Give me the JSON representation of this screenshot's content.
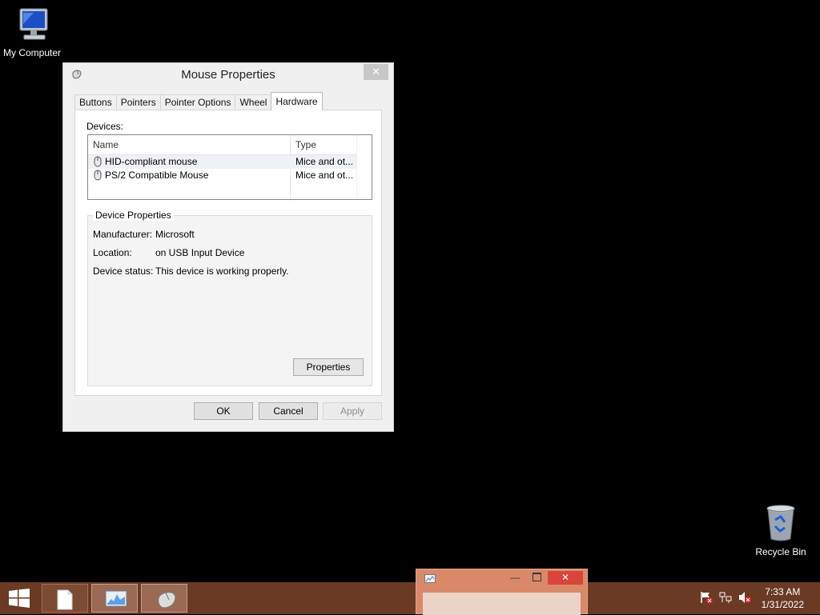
{
  "desktop": {
    "icons": [
      {
        "label": "My Computer",
        "icon": "computer-icon"
      },
      {
        "label": "Recycle Bin",
        "icon": "recycle-bin-icon"
      }
    ]
  },
  "dialog": {
    "title": "Mouse Properties",
    "close_label": "✕",
    "tabs": [
      {
        "label": "Buttons"
      },
      {
        "label": "Pointers"
      },
      {
        "label": "Pointer Options"
      },
      {
        "label": "Wheel"
      },
      {
        "label": "Hardware",
        "active": true
      }
    ],
    "devices_label": "Devices:",
    "columns": {
      "name": "Name",
      "type": "Type"
    },
    "devices": [
      {
        "name": "HID-compliant mouse",
        "type": "Mice and ot...",
        "selected": true
      },
      {
        "name": "PS/2 Compatible Mouse",
        "type": "Mice and ot..."
      }
    ],
    "device_properties": {
      "legend": "Device Properties",
      "manufacturer_label": "Manufacturer:",
      "manufacturer": "Microsoft",
      "location_label": "Location:",
      "location": "on USB Input Device",
      "status_label": "Device status:",
      "status": "This device is working properly.",
      "properties_button": "Properties"
    },
    "buttons": {
      "ok": "OK",
      "cancel": "Cancel",
      "apply": "Apply"
    }
  },
  "taskbar": {
    "clock_time": "7:33 AM",
    "clock_date": "1/31/2022",
    "accent": "#6a3a24"
  }
}
